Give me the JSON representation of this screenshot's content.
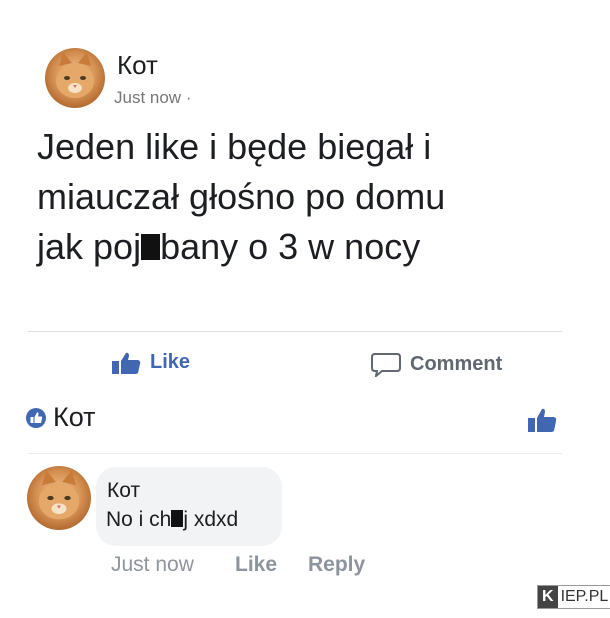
{
  "post": {
    "author": "Кот",
    "time": "Just now",
    "time_separator": "·",
    "text_line1": "Jeden like i będe biegał i",
    "text_line2": "miauczał głośno po domu",
    "text_line3_a": "jak poj",
    "text_line3_b": "bany o 3 w nocy"
  },
  "actions": {
    "like_label": "Like",
    "comment_label": "Comment"
  },
  "likes_summary": {
    "name": "Кот"
  },
  "comment": {
    "author": "Кот",
    "text_a": "No i ch",
    "text_b": "j xdxd",
    "time": "Just now",
    "like_label": "Like",
    "reply_label": "Reply"
  },
  "watermark": {
    "k": "K",
    "rest": "IEP.PL"
  },
  "colors": {
    "facebook_blue": "#4267b2",
    "meta_gray": "#90949c",
    "bubble_bg": "#f2f3f5"
  }
}
